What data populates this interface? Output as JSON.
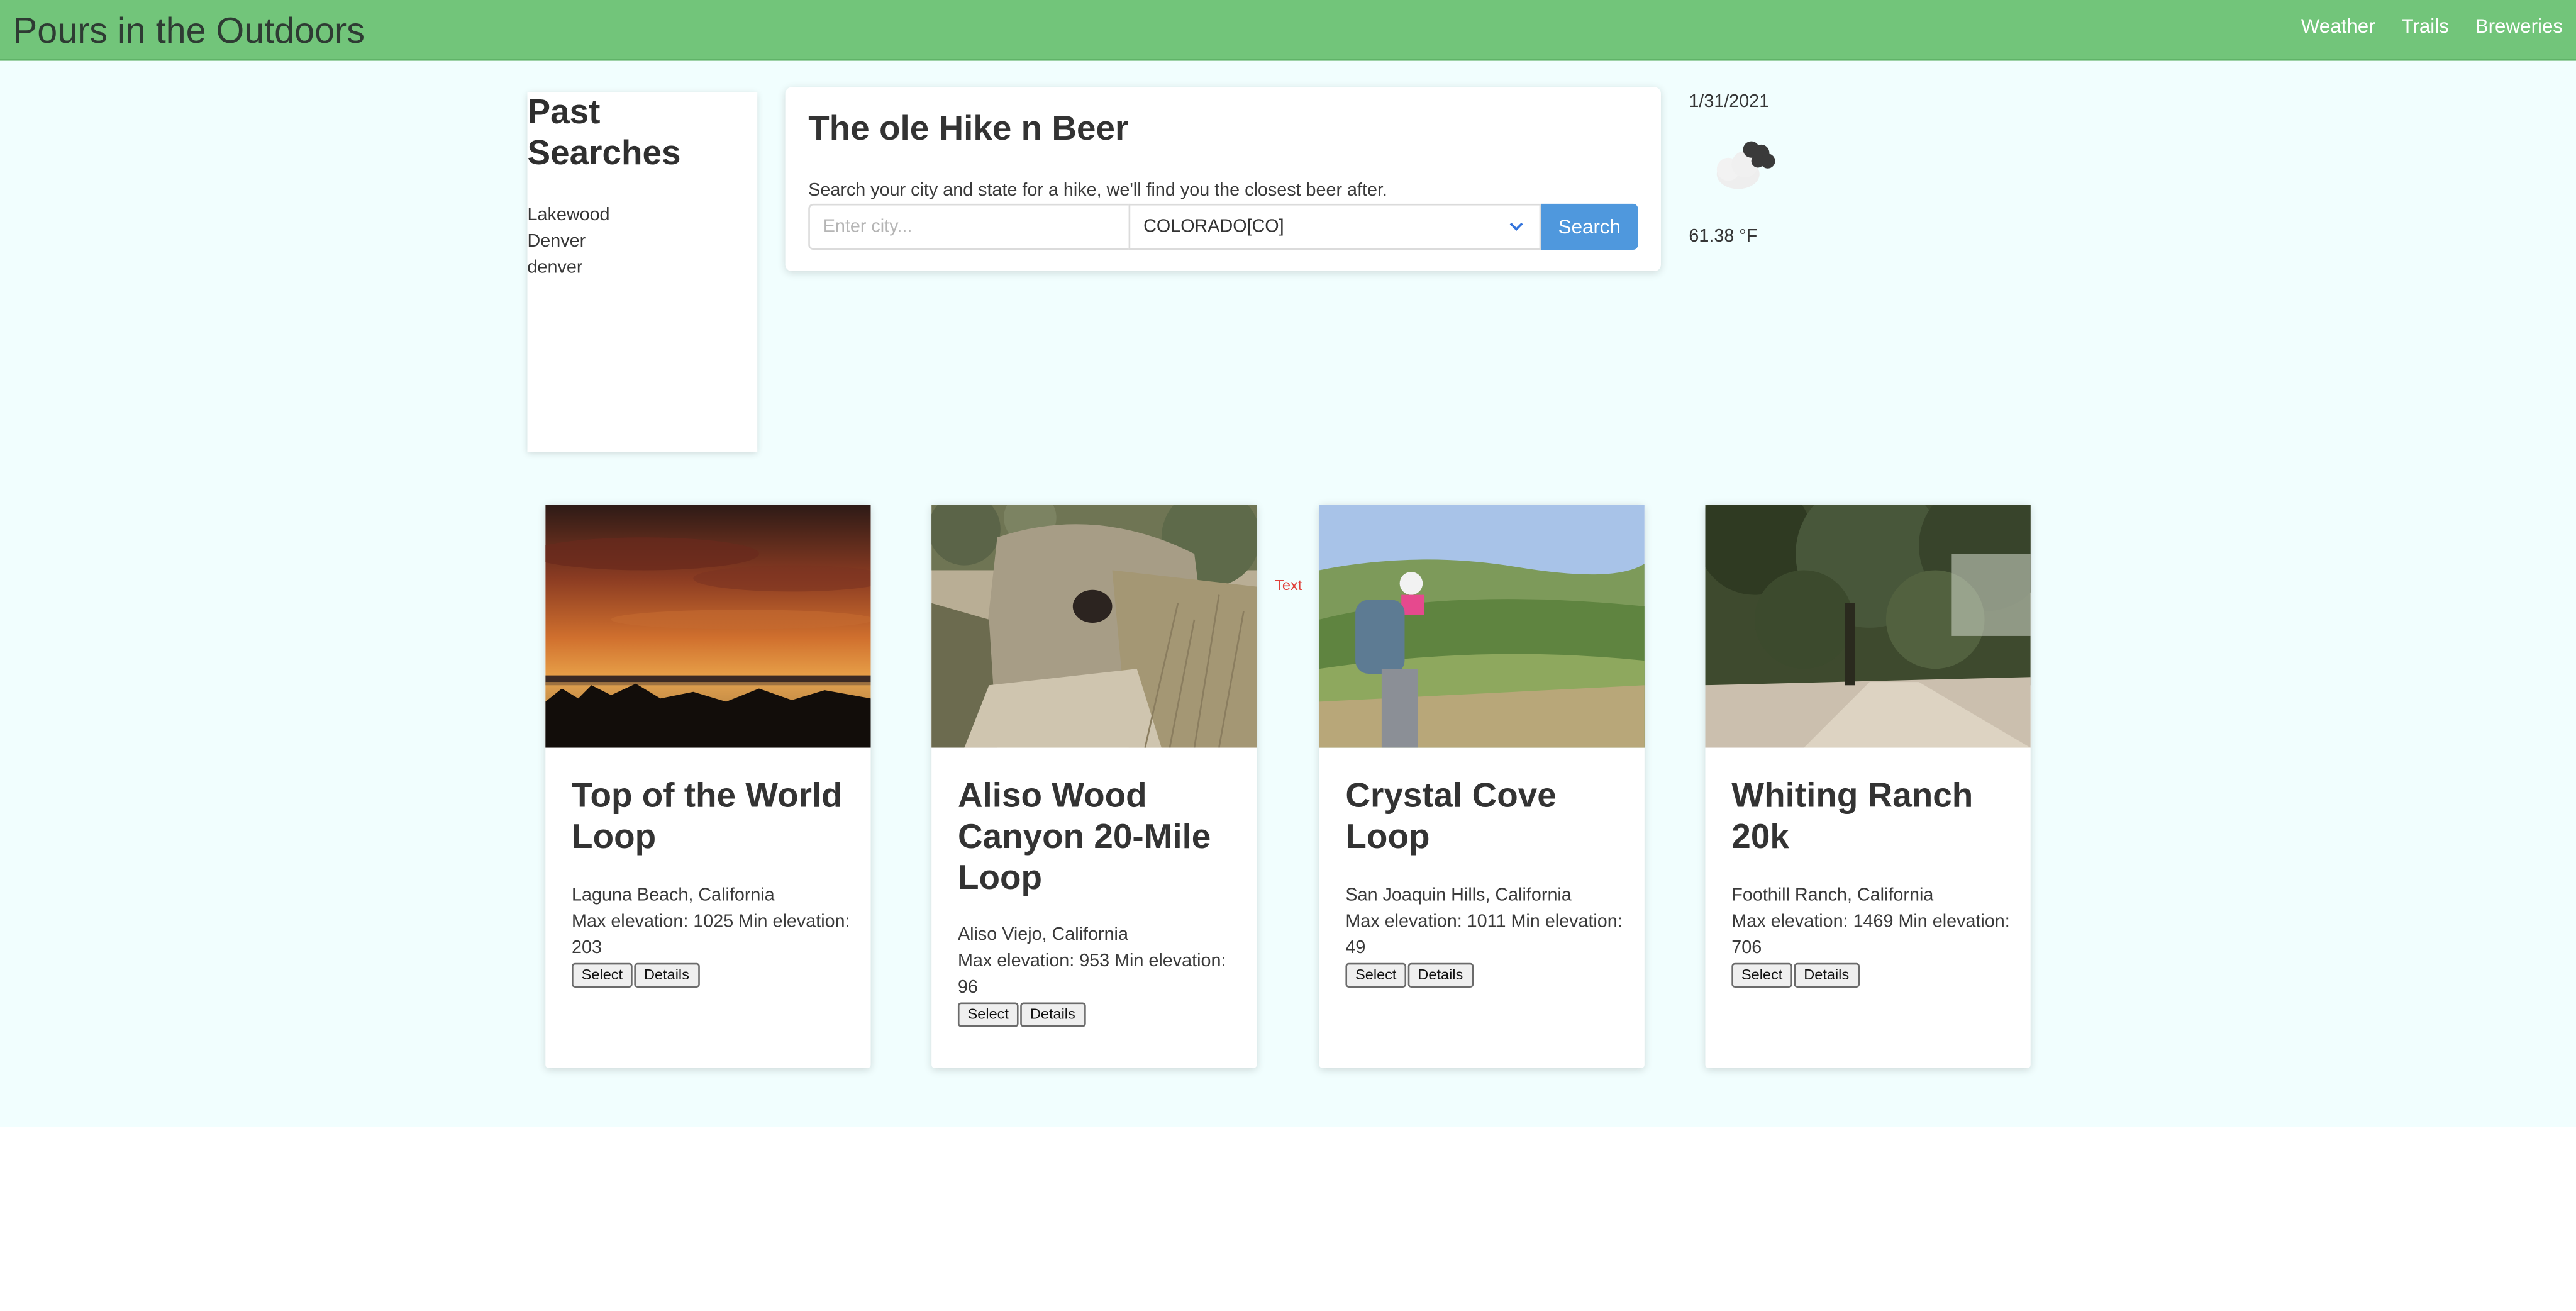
{
  "header": {
    "brand": "Pours in the Outdoors",
    "nav": [
      "Weather",
      "Trails",
      "Breweries"
    ],
    "bg_color": "#72c57a"
  },
  "past_searches": {
    "title": "Past Searches",
    "items": [
      "Lakewood",
      "Denver",
      "denver"
    ]
  },
  "search": {
    "title": "The ole Hike n Beer",
    "description": "Search your city and state for a hike, we'll find you the closest beer after.",
    "city_placeholder": "Enter city...",
    "state_selected": "COLORADO[CO]",
    "button_label": "Search",
    "button_color": "#4f98dd"
  },
  "weather": {
    "date": "1/31/2021",
    "icon": "cloudy-icon",
    "temperature": "61.38 °F"
  },
  "stray_label": "Text",
  "trails": [
    {
      "title": "Top of the World Loop",
      "location": "Laguna Beach, California",
      "elevation": "Max elevation: 1025 Min elevation: 203",
      "image": "sunset-ocean-photo"
    },
    {
      "title": "Aliso Wood Canyon 20-Mile Loop",
      "location": "Aliso Viejo, California",
      "elevation": "Max elevation: 953 Min elevation: 96",
      "image": "canyon-trail-photo"
    },
    {
      "title": "Crystal Cove Loop",
      "location": "San Joaquin Hills, California",
      "elevation": "Max elevation: 1011 Min elevation: 49",
      "image": "hiker-hills-photo"
    },
    {
      "title": "Whiting Ranch 20k",
      "location": "Foothill Ranch, California",
      "elevation": "Max elevation: 1469 Min elevation: 706",
      "image": "oak-trail-photo"
    }
  ],
  "card_buttons": {
    "select": "Select",
    "details": "Details"
  },
  "page_bg_color": "#f1fefe"
}
